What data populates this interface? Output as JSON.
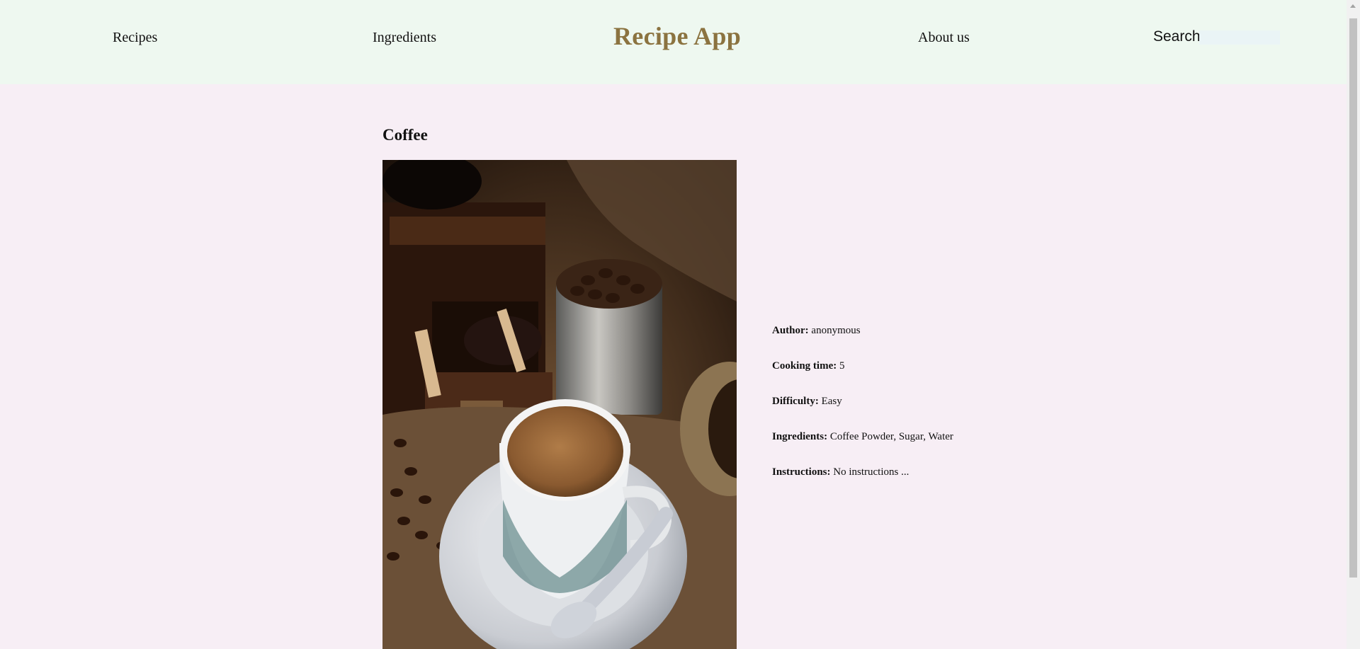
{
  "nav": {
    "recipes": "Recipes",
    "ingredients": "Ingredients",
    "brand": "Recipe App",
    "about": "About us",
    "search_label": "Search",
    "search_value": "",
    "search_placeholder": ""
  },
  "recipe": {
    "title": "Coffee",
    "details": [
      {
        "label": "Author:",
        "value": "anonymous"
      },
      {
        "label": "Cooking time:",
        "value": "5"
      },
      {
        "label": "Difficulty:",
        "value": "Easy"
      },
      {
        "label": "Ingredients:",
        "value": "Coffee Powder, Sugar, Water"
      },
      {
        "label": "Instructions:",
        "value": "No instructions ..."
      }
    ]
  },
  "colors": {
    "header_bg": "#eef8f0",
    "page_bg": "#f7eef5",
    "brand": "#8b7340"
  },
  "icons": {
    "scroll_up": "scroll-up-arrow-icon"
  }
}
